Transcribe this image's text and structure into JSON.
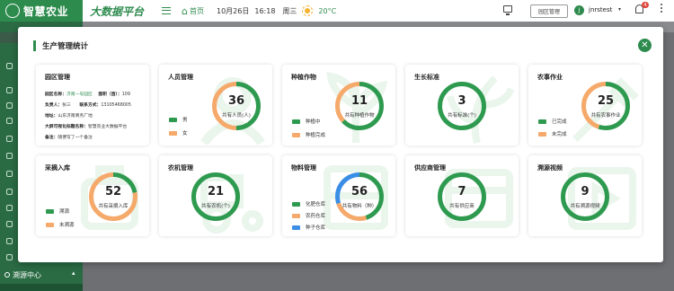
{
  "header": {
    "logo_text": "智慧农业",
    "platform_title": "大数据平台",
    "home_label": "首页",
    "date": "10月26日",
    "time": "16:18",
    "weekday": "周三",
    "weather_icon": "sun-icon",
    "temperature": "20°C",
    "park_button": "园区管理",
    "avatar_letter": "J",
    "username": "jnrstest",
    "notification_count": "4"
  },
  "sidebar": {
    "menu_label": "溯源中心"
  },
  "modal": {
    "title": "生产管理统计",
    "close_icon": "close-icon"
  },
  "park": {
    "title": "园区管理",
    "rows": [
      {
        "k": "园区名称：",
        "v": "济南一号园区",
        "k2": "面积（亩）：",
        "v2": "109"
      },
      {
        "k": "负责人：",
        "v": "张三",
        "k2": "联系方式：",
        "v2": "13105468005"
      },
      {
        "k": "地址：",
        "v": "山东济南商务厂地",
        "k2": "",
        "v2": ""
      },
      {
        "k": "大屏可视化标题名称：",
        "v": "智慧农业大数据平台",
        "k2": "",
        "v2": ""
      },
      {
        "k": "备注：",
        "v": "随便写了一个备注",
        "k2": "",
        "v2": ""
      }
    ]
  },
  "cards": [
    {
      "title": "人员管理",
      "value": "36",
      "label": "共有人员(人)",
      "legend": [
        {
          "name": "男",
          "color": "#2e9a4f"
        },
        {
          "name": "女",
          "color": "#f5a96b"
        }
      ]
    },
    {
      "title": "种植作物",
      "value": "11",
      "label": "共有种植作物",
      "legend": [
        {
          "name": "种植中",
          "color": "#2e9a4f"
        },
        {
          "name": "种植完成",
          "color": "#f5a96b"
        }
      ]
    },
    {
      "title": "生长标准",
      "value": "3",
      "label": "共有标准(个)",
      "legend": []
    },
    {
      "title": "农事作业",
      "value": "25",
      "label": "共有农事作业",
      "legend": [
        {
          "name": "已完成",
          "color": "#2e9a4f"
        },
        {
          "name": "未完成",
          "color": "#f5a96b"
        }
      ]
    },
    {
      "title": "采摘入库",
      "value": "52",
      "label": "共有采摘入库",
      "legend": [
        {
          "name": "溯源",
          "color": "#2e9a4f"
        },
        {
          "name": "未溯源",
          "color": "#f5a96b"
        }
      ]
    },
    {
      "title": "农机管理",
      "value": "21",
      "label": "共有农机(个)",
      "legend": []
    },
    {
      "title": "物料管理",
      "value": "56",
      "label": "共有物料（种）",
      "legend": [
        {
          "name": "化肥仓库",
          "color": "#2e9a4f"
        },
        {
          "name": "农药仓库",
          "color": "#f5a96b"
        },
        {
          "name": "种子仓库",
          "color": "#3a8ee6"
        }
      ]
    },
    {
      "title": "供应商管理",
      "value": "7",
      "label": "共有供应商",
      "legend": []
    },
    {
      "title": "溯源视频",
      "value": "9",
      "label": "共有溯源视频",
      "legend": []
    }
  ],
  "ring_fractions": [
    [
      0.5,
      0.5
    ],
    [
      0.63,
      0.37
    ],
    [
      1.0
    ],
    [
      0.55,
      0.45
    ],
    [
      0.22,
      0.78
    ],
    [
      1.0
    ],
    [
      0.45,
      0.25,
      0.3
    ],
    [
      1.0
    ],
    [
      1.0
    ]
  ],
  "colors": {
    "brand": "#2e8b4e",
    "ring_green": "#2e9a4f",
    "ring_orange": "#f5a96b",
    "ring_blue": "#3a8ee6",
    "watermark": "#eaf5ec"
  }
}
